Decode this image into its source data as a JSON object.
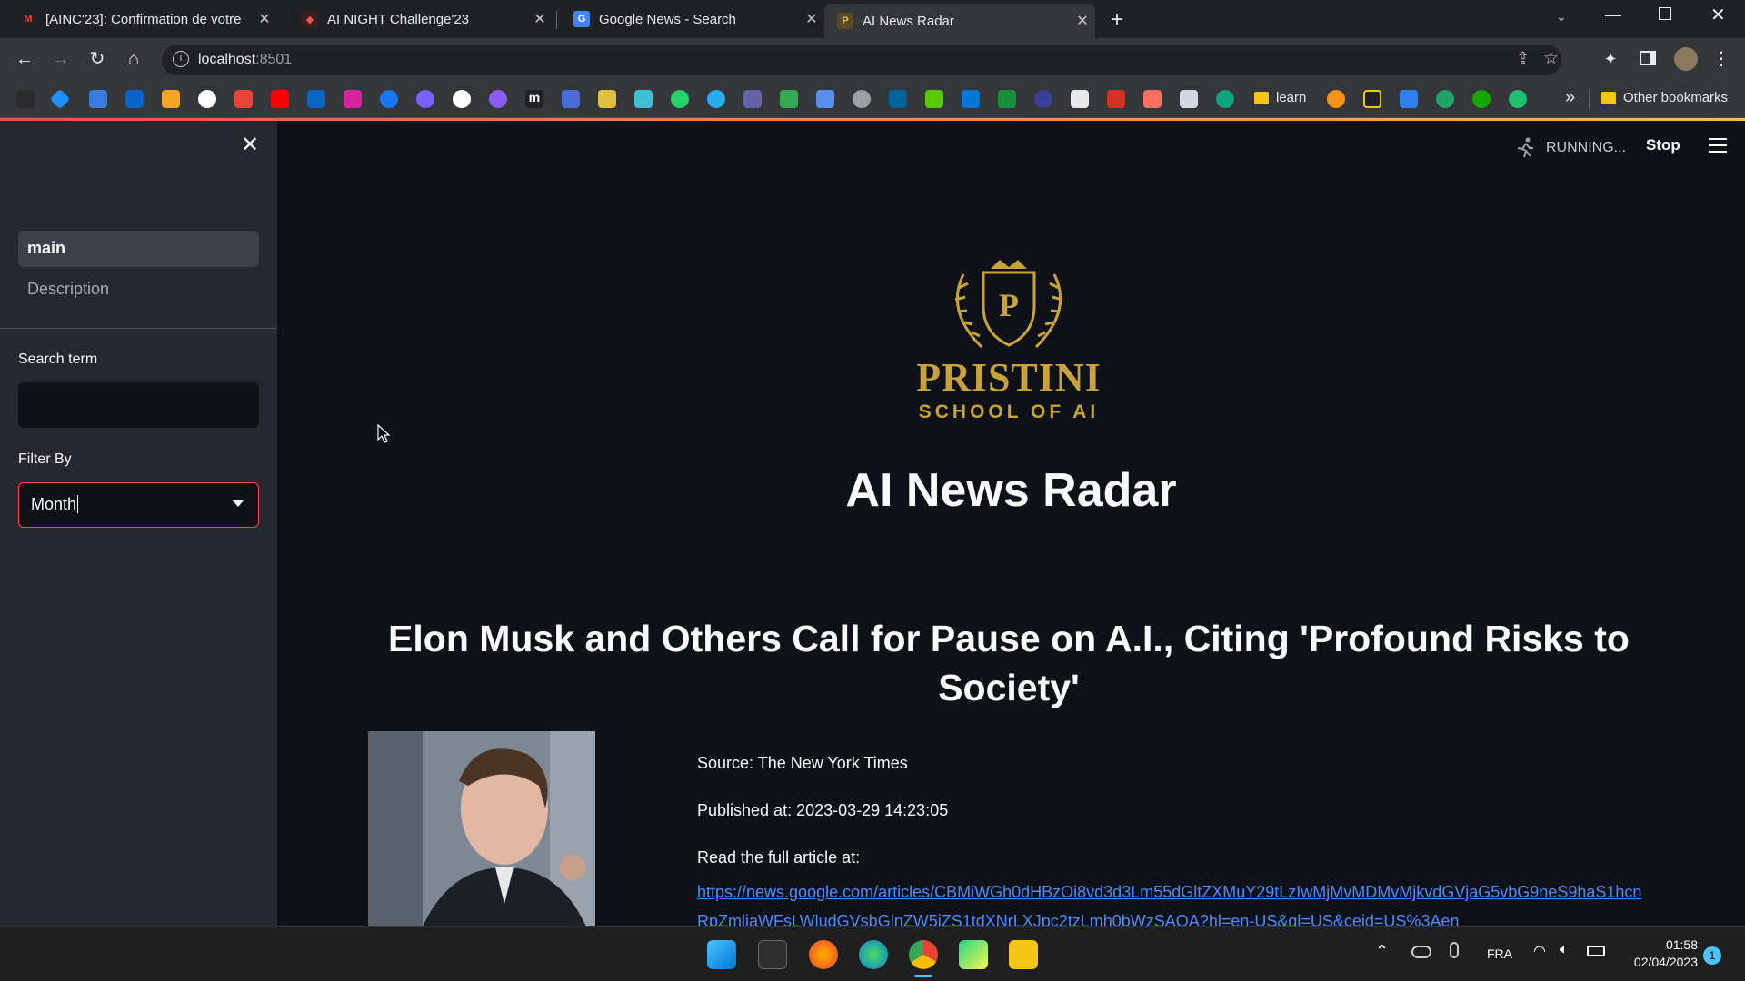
{
  "browser": {
    "tabs": [
      {
        "title": "[AINC'23]: Confirmation de votre",
        "icon": "gmail-icon"
      },
      {
        "title": "AI NIGHT Challenge'23",
        "icon": "ai-night-icon"
      },
      {
        "title": "Google News - Search",
        "icon": "google-news-icon"
      },
      {
        "title": "AI News Radar",
        "icon": "streamlit-icon"
      }
    ],
    "url_host": "localhost",
    "url_port": ":8501",
    "bookmarks": {
      "learn_label": "learn",
      "other_label": "Other bookmarks",
      "overflow": "»"
    }
  },
  "sidebar": {
    "nav": [
      {
        "label": "main"
      },
      {
        "label": "Description"
      }
    ],
    "search_label": "Search term",
    "search_value": "",
    "filter_label": "Filter By",
    "filter_value": "Month"
  },
  "header": {
    "status": "RUNNING...",
    "stop_label": "Stop"
  },
  "logo": {
    "letter": "P",
    "name": "PRISTINI",
    "tagline": "SCHOOL OF AI",
    "color": "#c9a23a"
  },
  "main": {
    "app_title": "AI News Radar",
    "article": {
      "title": "Elon Musk and Others Call for Pause on A.I., Citing 'Profound Risks to Society'",
      "source": "Source: The New York Times",
      "published": "Published at: 2023-03-29 14:23:05",
      "read_label": "Read the full article at:",
      "link": "https://news.google.com/articles/CBMiWGh0dHBzOi8vd3d3Lm55dGltZXMuY29tLzIwMjMvMDMvMjkvdGVjaG5vbG9neS9haS1hcnRpZmljaWFsLWludGVsbGlnZW5jZS1tdXNrLXJpc2tzLmh0bWzSAQA?hl=en-US&gl=US&ceid=US%3Aen"
    }
  },
  "taskbar": {
    "language": "FRA",
    "time": "01:58",
    "date": "02/04/2023",
    "notifications": "1"
  }
}
